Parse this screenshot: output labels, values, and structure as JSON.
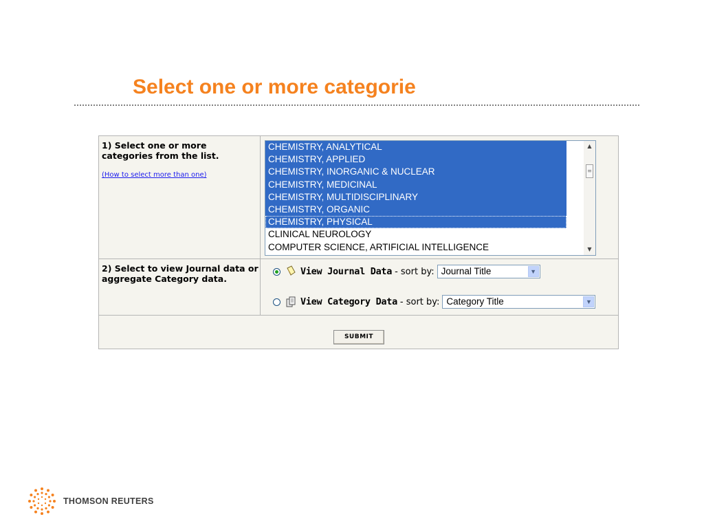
{
  "slide": {
    "title": "Select one or more categorie"
  },
  "step1": {
    "label": "1) Select one or more categories from the list.",
    "help_link": "(How to select more than one)",
    "options": [
      {
        "text": "CHEMISTRY, ANALYTICAL",
        "selected": true
      },
      {
        "text": "CHEMISTRY, APPLIED",
        "selected": true
      },
      {
        "text": "CHEMISTRY, INORGANIC & NUCLEAR",
        "selected": true
      },
      {
        "text": "CHEMISTRY, MEDICINAL",
        "selected": true
      },
      {
        "text": "CHEMISTRY, MULTIDISCIPLINARY",
        "selected": true
      },
      {
        "text": "CHEMISTRY, ORGANIC",
        "selected": true
      },
      {
        "text": "CHEMISTRY, PHYSICAL",
        "selected": true
      },
      {
        "text": "CLINICAL NEUROLOGY",
        "selected": false
      },
      {
        "text": "COMPUTER SCIENCE, ARTIFICIAL INTELLIGENCE",
        "selected": false
      }
    ],
    "scroll_up_icon": "triangle-up",
    "scroll_down_icon": "triangle-down"
  },
  "step2": {
    "label": "2) Select to view Journal data or aggregate Category data.",
    "journal": {
      "label": "View Journal Data",
      "sort_by": "- sort by:",
      "selected_value": "Journal Title",
      "checked": true,
      "icon": "journal-icon"
    },
    "category": {
      "label": "View Category Data",
      "sort_by": "- sort by:",
      "selected_value": "Category Title",
      "checked": false,
      "icon": "category-icon"
    }
  },
  "submit_label": "SUBMIT",
  "brand": {
    "name": "THOMSON REUTERS",
    "logo_color": "#f5821f"
  },
  "colors": {
    "title": "#f5821f",
    "selection": "#316ac5",
    "link": "#1a1aee"
  }
}
